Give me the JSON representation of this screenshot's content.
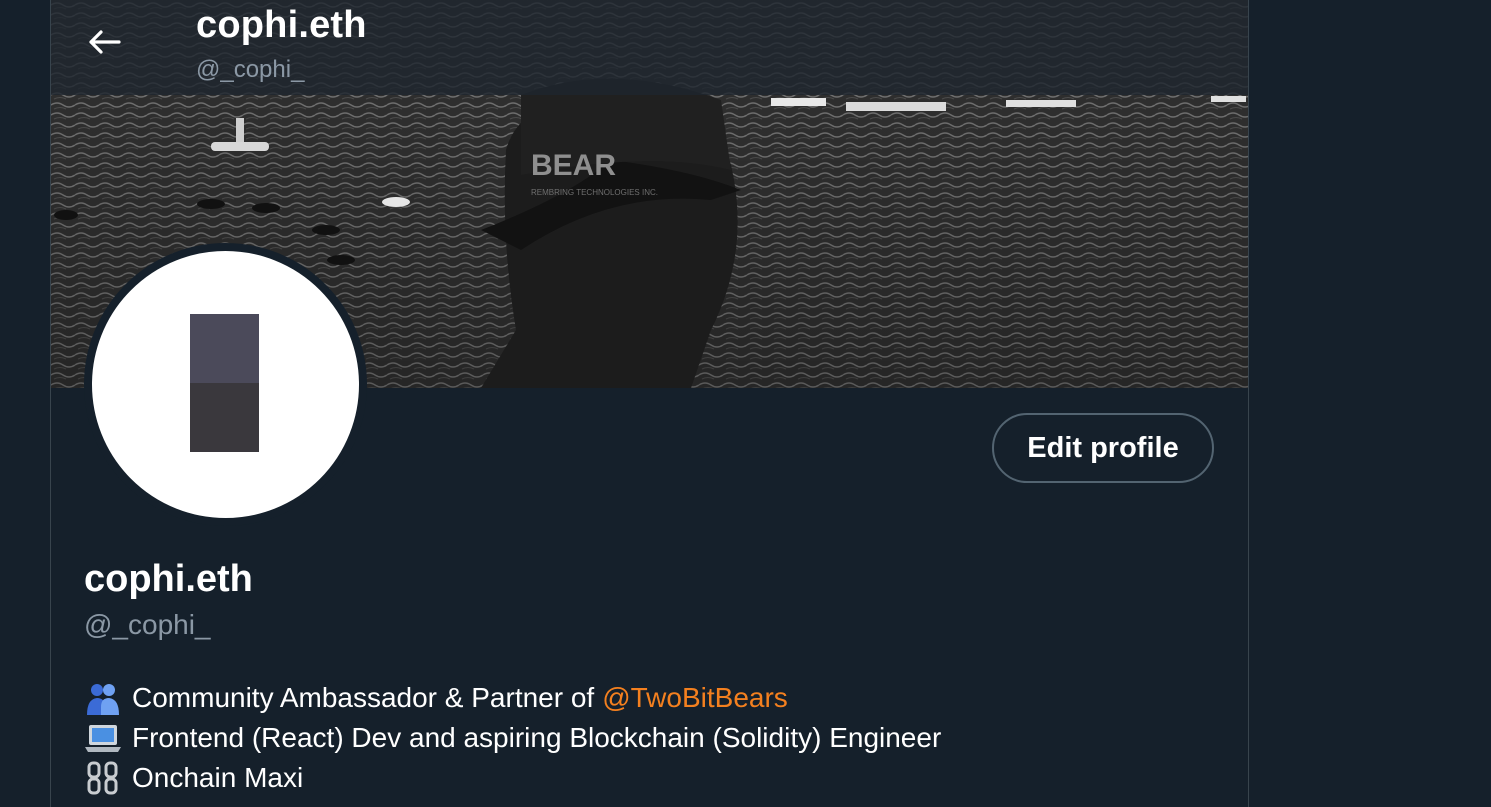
{
  "header": {
    "name": "cophi.eth",
    "handle": "@_cophi_"
  },
  "banner": {
    "cap_text": "BEAR",
    "cap_subtext": "REMBRING TECHNOLOGIES INC."
  },
  "actions": {
    "edit_profile_label": "Edit profile"
  },
  "profile": {
    "name": "cophi.eth",
    "handle": "@_cophi_",
    "bio": [
      {
        "icon": "people-hugging-icon",
        "text": "Community Ambassador & Partner of",
        "mention": "@TwoBitBears"
      },
      {
        "icon": "laptop-icon",
        "text": "Frontend (React) Dev and aspiring Blockchain (Solidity) Engineer"
      },
      {
        "icon": "chain-icon",
        "text": "Onchain Maxi"
      }
    ]
  },
  "colors": {
    "background": "#15202b",
    "mention": "#f4801f",
    "secondary_text": "#8b98a5",
    "border": "#536471"
  }
}
